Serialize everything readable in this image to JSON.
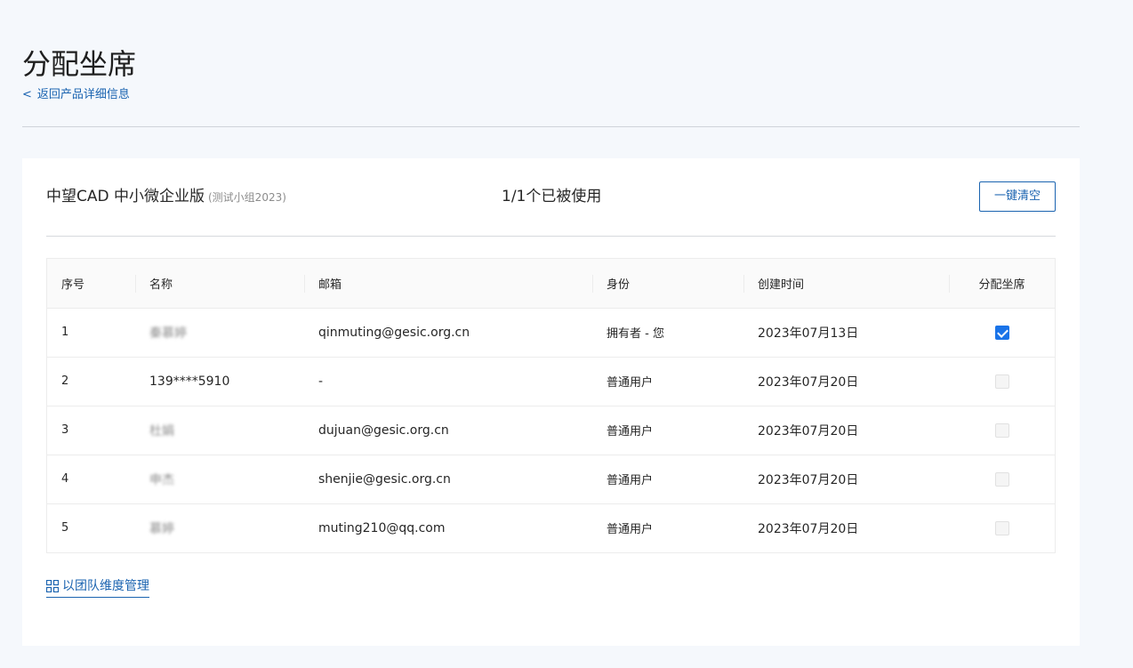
{
  "page": {
    "title": "分配坐席",
    "back_link": "返回产品详细信息"
  },
  "product": {
    "name": "中望CAD 中小微企业版",
    "team": "(测试小组2023)",
    "usage": "1/1个已被使用",
    "clear_button": "一键清空"
  },
  "table": {
    "columns": [
      "序号",
      "名称",
      "邮箱",
      "身份",
      "创建时间",
      "分配坐席"
    ],
    "rows": [
      {
        "index": "1",
        "name": "秦慕婷",
        "email": "qinmuting@gesic.org.cn",
        "role": "拥有者 - 您",
        "created": "2023年07月13日",
        "assigned": true
      },
      {
        "index": "2",
        "name": "139****5910",
        "email": "-",
        "role": "普通用户",
        "created": "2023年07月20日",
        "assigned": false
      },
      {
        "index": "3",
        "name": "杜娟",
        "email": "dujuan@gesic.org.cn",
        "role": "普通用户",
        "created": "2023年07月20日",
        "assigned": false
      },
      {
        "index": "4",
        "name": "申杰",
        "email": "shenjie@gesic.org.cn",
        "role": "普通用户",
        "created": "2023年07月20日",
        "assigned": false
      },
      {
        "index": "5",
        "name": "慕婷",
        "email": "muting210@qq.com",
        "role": "普通用户",
        "created": "2023年07月20日",
        "assigned": false
      }
    ]
  },
  "footer": {
    "team_link": "以团队维度管理"
  },
  "colors": {
    "accent": "#1a63b0",
    "checkbox": "#1a73e8",
    "background": "#f5f8fc"
  },
  "icons": {
    "back": "chevron-left-icon",
    "team": "grid-icon"
  }
}
